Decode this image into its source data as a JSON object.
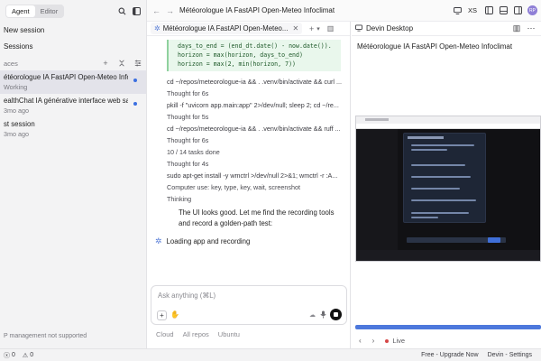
{
  "sidebar": {
    "modes": [
      "Agent",
      "Editor"
    ],
    "new_session": "New session",
    "sessions_link": "Sessions",
    "section_label": "aces",
    "sessions": [
      {
        "title": "étéorologue IA FastAPI Open-Meteo Infoc...",
        "sub": "Working",
        "active": true,
        "dot": true
      },
      {
        "title": "ealthChat IA générative interface web sa...",
        "sub": "3mo ago",
        "active": false,
        "dot": true
      },
      {
        "title": "st session",
        "sub": "3mo ago",
        "active": false,
        "dot": false
      }
    ],
    "footer": "P management not supported"
  },
  "topbar": {
    "title": "Météorologue IA FastAPI Open-Meteo Infoclimat",
    "size_label": "XS",
    "avatar_initials": "RP"
  },
  "chat": {
    "tab_title": "Météorologue IA FastAPI Open-Meteo...",
    "code_lines": [
      "days_to_end = (end_dt.date() - now.date()).",
      "horizon = max(horizon, days_to_end)",
      "horizon = max(2, min(horizon, 7))"
    ],
    "log": [
      "cd ~/repos/meteorologue-ia && . .venv/bin/activate && curl ...",
      "Thought for 6s",
      "pkill -f \"uvicorn app.main:app\" 2>/dev/null; sleep 2; cd ~/re...",
      "Thought for 5s",
      "cd ~/repos/meteorologue-ia && . .venv/bin/activate && ruff ...",
      "Thought for 6s",
      "10 / 14 tasks done",
      "Thought for 4s",
      "sudo apt-get install -y wmctrl >/dev/null 2>&1; wmctrl -r :A...",
      "Computer use: key, type, key, wait, screenshot",
      "Thinking"
    ],
    "message": "The UI looks good. Let me find the recording tools and record a golden-path test:",
    "status": "Loading app and recording",
    "composer_placeholder": "Ask anything (⌘L)",
    "env": [
      "Cloud",
      "All repos",
      "Ubuntu"
    ]
  },
  "desktop": {
    "tab_label": "Devin Desktop",
    "title": "Météorologue IA FastAPI Open-Meteo Infoclimat",
    "progress": 1.0,
    "live_label": "Live"
  },
  "statusbar": {
    "errors": "0",
    "warnings": "0",
    "upgrade": "Free - Upgrade Now",
    "settings": "Devin - Settings"
  }
}
